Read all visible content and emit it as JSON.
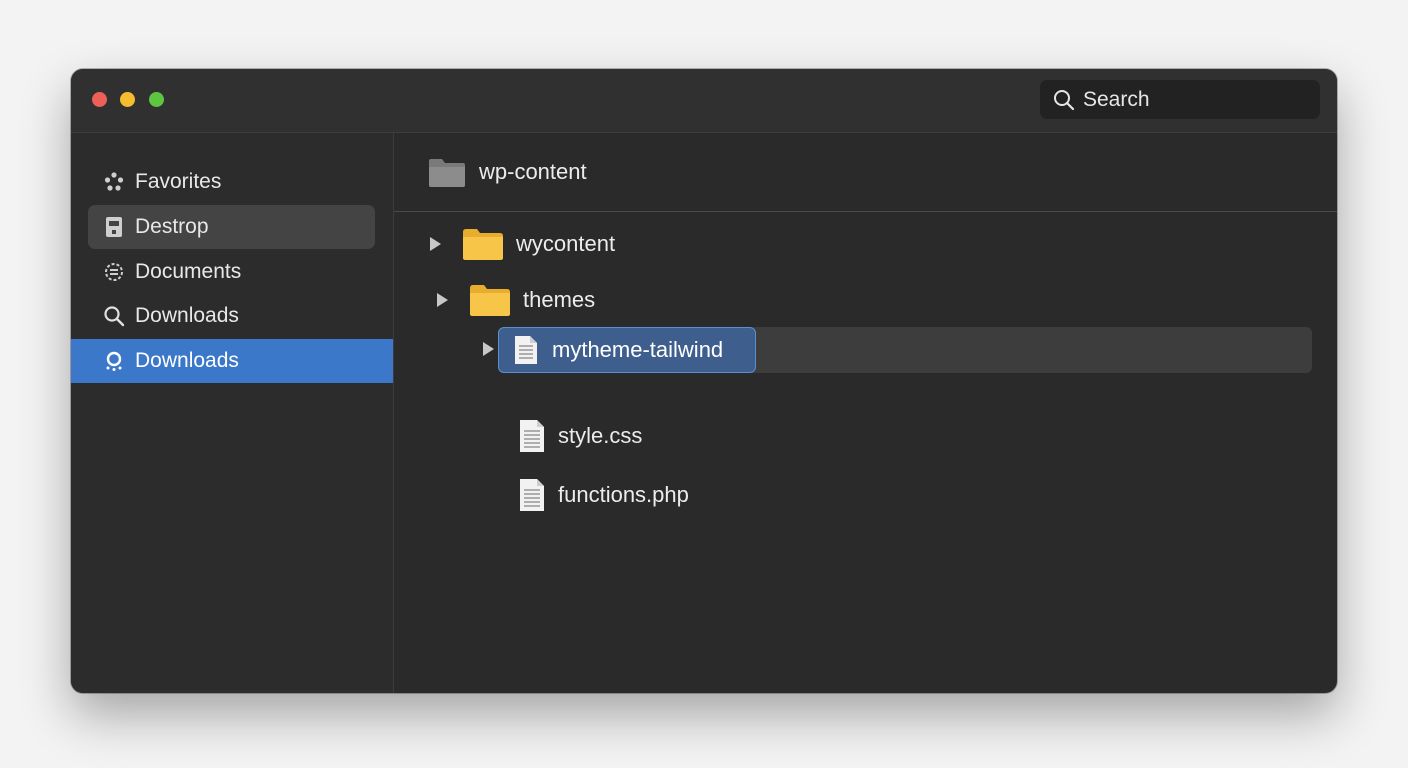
{
  "search": {
    "placeholder": "Search"
  },
  "sidebar": {
    "items": [
      {
        "label": "Favorites",
        "icon": "favorites-icon",
        "state": "normal"
      },
      {
        "label": "Destrop",
        "icon": "desktop-icon",
        "state": "hover"
      },
      {
        "label": "Documents",
        "icon": "documents-icon",
        "state": "normal"
      },
      {
        "label": "Downloads",
        "icon": "search-icon",
        "state": "normal"
      },
      {
        "label": "Downloads",
        "icon": "downloads-icon",
        "state": "selected"
      }
    ]
  },
  "content": {
    "path_title": "wp-content",
    "tree": [
      {
        "label": "wycontent",
        "type": "folder",
        "expandable": true
      },
      {
        "label": "themes",
        "type": "folder",
        "expandable": true
      },
      {
        "label": "mytheme-tailwind",
        "type": "file",
        "expandable": true,
        "selected": true
      },
      {
        "label": "style.css",
        "type": "file",
        "expandable": false
      },
      {
        "label": "functions.php",
        "type": "file",
        "expandable": false
      }
    ]
  },
  "colors": {
    "window_bg": "#2a2a2a",
    "sidebar_selected": "#3b78c9",
    "row_selected": "#3e5f8e",
    "folder_yellow": "#f7c547"
  }
}
